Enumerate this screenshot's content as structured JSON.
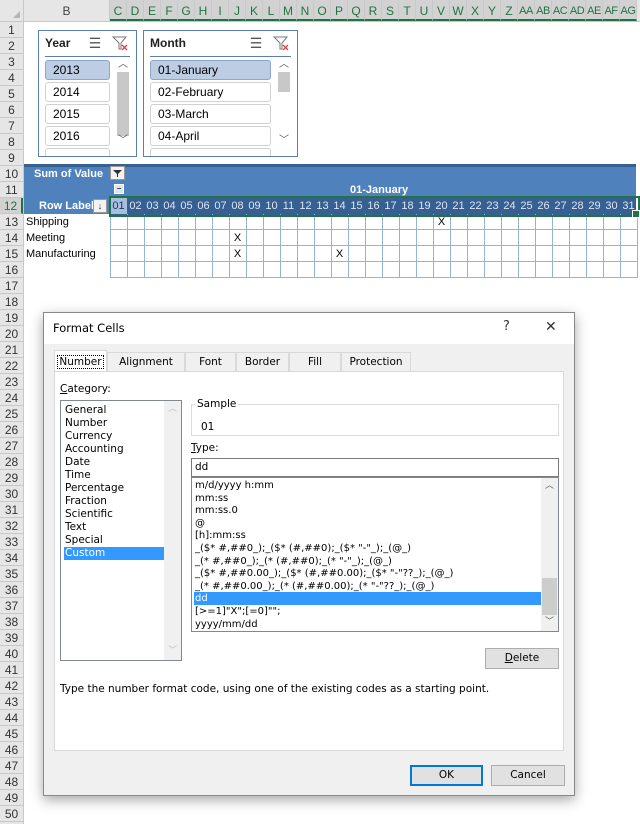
{
  "sheet": {
    "columns": [
      "B",
      "C",
      "D",
      "E",
      "F",
      "G",
      "H",
      "I",
      "J",
      "K",
      "L",
      "M",
      "N",
      "O",
      "P",
      "Q",
      "R",
      "S",
      "T",
      "U",
      "V",
      "W",
      "X",
      "Y",
      "Z",
      "AA",
      "AB",
      "AC",
      "AD",
      "AE",
      "AF",
      "AG"
    ],
    "rows": [
      "1",
      "2",
      "3",
      "4",
      "5",
      "6",
      "7",
      "8",
      "9",
      "10",
      "11",
      "12",
      "13",
      "14",
      "15",
      "16",
      "17",
      "18",
      "19",
      "20",
      "21",
      "22",
      "23",
      "24",
      "25",
      "26",
      "27",
      "28",
      "29",
      "30",
      "31",
      "32",
      "33",
      "34",
      "35",
      "36",
      "37",
      "38",
      "39",
      "40",
      "41",
      "42",
      "43",
      "44",
      "45",
      "46",
      "47",
      "48",
      "49",
      "50"
    ],
    "selected_row": "12"
  },
  "slicers": {
    "year": {
      "title": "Year",
      "items": [
        "2013",
        "2014",
        "2015",
        "2016"
      ],
      "selected": "2013"
    },
    "month": {
      "title": "Month",
      "items": [
        "01-January",
        "02-February",
        "03-March",
        "04-April"
      ],
      "selected": "01-January"
    }
  },
  "pivot": {
    "value_label": "Sum of Value",
    "column_group": "01-January",
    "collapse_symbol": "−",
    "row_labels_header": "Row Labels",
    "days": [
      "01",
      "02",
      "03",
      "04",
      "05",
      "06",
      "07",
      "08",
      "09",
      "10",
      "11",
      "12",
      "13",
      "14",
      "15",
      "16",
      "17",
      "18",
      "19",
      "20",
      "21",
      "22",
      "23",
      "24",
      "25",
      "26",
      "27",
      "28",
      "29",
      "30",
      "31"
    ],
    "rows": [
      {
        "label": "Shipping",
        "marks": {
          "20": "X"
        }
      },
      {
        "label": "Meeting",
        "marks": {
          "08": "X"
        }
      },
      {
        "label": "Manufacturing",
        "marks": {
          "08": "X",
          "14": "X"
        }
      }
    ]
  },
  "dialog": {
    "title": "Format Cells",
    "help": "?",
    "close": "✕",
    "tabs": [
      "Number",
      "Alignment",
      "Font",
      "Border",
      "Fill",
      "Protection"
    ],
    "active_tab": "Number",
    "category_label": "Category:",
    "categories": [
      "General",
      "Number",
      "Currency",
      "Accounting",
      "Date",
      "Time",
      "Percentage",
      "Fraction",
      "Scientific",
      "Text",
      "Special",
      "Custom"
    ],
    "selected_category": "Custom",
    "sample_label": "Sample",
    "sample_value": "01",
    "type_label": "Type:",
    "type_value": "dd",
    "type_list": [
      "m/d/yyyy h:mm",
      "mm:ss",
      "mm:ss.0",
      "@",
      "[h]:mm:ss",
      "_($* #,##0_);_($* (#,##0);_($* \"-\"_);_(@_)",
      "_(* #,##0_);_(* (#,##0);_(* \"-\"_);_(@_)",
      "_($* #,##0.00_);_($* (#,##0.00);_($* \"-\"??_);_(@_)",
      "_(* #,##0.00_);_(* (#,##0.00);_(* \"-\"??_);_(@_)",
      "dd",
      "[>=1]\"X\";[=0]\"\";",
      "yyyy/mm/dd"
    ],
    "selected_type": "dd",
    "delete_label": "Delete",
    "hint": "Type the number format code, using one of the existing codes as a starting point.",
    "ok_label": "OK",
    "cancel_label": "Cancel"
  }
}
